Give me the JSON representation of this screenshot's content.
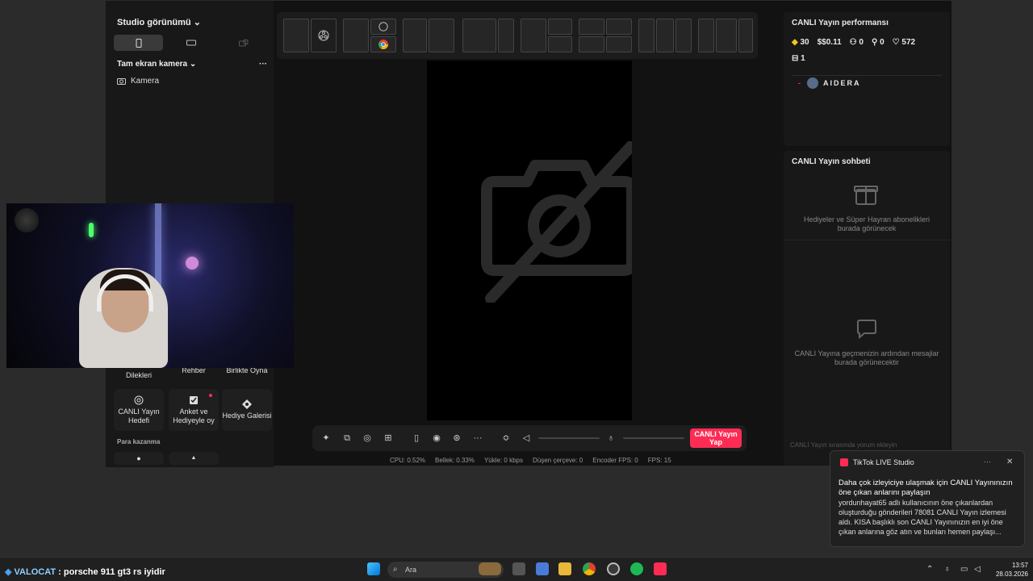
{
  "sidebar": {
    "title": "Studio görünümü",
    "scene": "Tam ekran kamera",
    "scene_menu": "···",
    "source": "Kamera",
    "tools": [
      {
        "label": "Dilekleri"
      },
      {
        "label": "Rehber"
      },
      {
        "label": "Birlikte Oyna"
      },
      {
        "label": "CANLI Yayın Hedefi"
      },
      {
        "label": "Anket ve Hediyeyle oy"
      },
      {
        "label": "Hediye Galerisi"
      }
    ],
    "section_label": "Para kazanma"
  },
  "controls": {
    "go_live": "CANLI Yayın Yap"
  },
  "stats": {
    "cpu": "CPU: 0.52%",
    "memory": "Bellek: 0.33%",
    "upload": "Yükle: 0 kbps",
    "dropped": "Düşen çerçeve: 0",
    "encoder": "Encoder FPS: 0",
    "fps": "FPS: 15"
  },
  "performance": {
    "title": "CANLI Yayın performansı",
    "diamonds": "30",
    "earnings": "$0.11",
    "viewers": "0",
    "new_followers": "0",
    "likes": "572",
    "gifts": "1",
    "top_viewer": "AIDERA"
  },
  "chat": {
    "title": "CANLI Yayın sohbeti",
    "gifts_empty": "Hediyeler ve Süper Hayran abonelikleri burada görünecek",
    "messages_empty": "CANLI Yayına geçmenizin ardından mesajlar burada görünecektir",
    "input_placeholder": "CANLI Yayın sırasında yorum ekleyin"
  },
  "toast": {
    "app": "TikTok LIVE Studio",
    "menu": "···",
    "close": "✕",
    "headline": "Daha çok izleyiciye ulaşmak için CANLI Yayınınızın öne çıkan anlarını paylaşın",
    "body": "yordunhayat65 adlı kullanıcının öne çıkanlardan oluşturduğu gönderileri 78081 CANLI Yayın izlemesi aldı. KISA başlıklı son CANLI Yayınınızın en iyi öne çıkan anlarına göz atın ve bunları hemen paylaşı..."
  },
  "overlay_chat": {
    "user": "VALOCAT",
    "message": ": porsche 911 gt3 rs iyidir"
  },
  "taskbar": {
    "search_placeholder": "Ara",
    "time": "13:57",
    "date": "28.03.2026"
  },
  "colors": {
    "accent": "#fe2c55",
    "background": "#121212",
    "panel": "#181818"
  }
}
